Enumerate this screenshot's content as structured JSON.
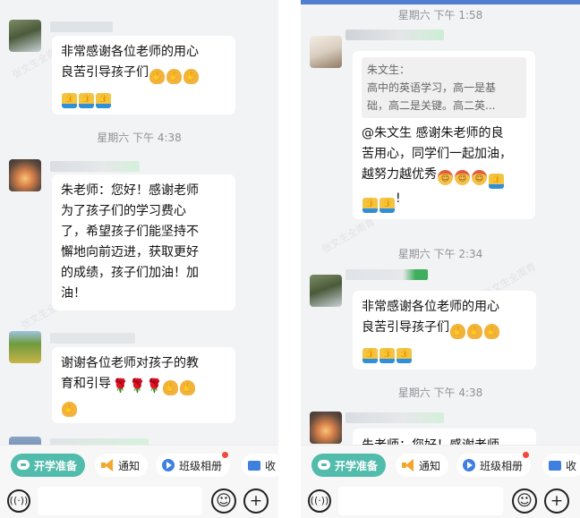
{
  "left": {
    "messages": {
      "m1": {
        "line1": "非常感谢各位老师的用心",
        "line2": "良苦引导孩子们"
      },
      "time1": "星期六  下午 4:38",
      "m2": {
        "lines": [
          "朱老师：您好！感谢老师",
          "为了孩子们的学习费心",
          "了，希望孩子们能坚持不",
          "懈地向前迈进，获取更好",
          "的成绩，孩子们加油！加",
          "油！"
        ]
      },
      "m3": {
        "line1": "谢谢各位老师对孩子的教",
        "line2": "育和引导"
      }
    },
    "toolbar": {
      "start_label": "开学准备",
      "notice_label": "通知",
      "album_label": "班级相册",
      "more_label": "收"
    }
  },
  "right": {
    "messages": {
      "time0": "星期六  下午 1:58",
      "quote": {
        "author": "朱文生：",
        "line1": "高中的英语学习，高一是基",
        "line2": "础，高二是关键。高二英..."
      },
      "reply": {
        "line1": "@朱文生 感谢朱老师的良",
        "line2": "苦用心，同学们一起加油，",
        "line3": "越努力越优秀"
      },
      "time1": "星期六  下午 2:34",
      "m1": {
        "line1": "非常感谢各位老师的用心",
        "line2": "良苦引导孩子们"
      },
      "time2": "星期六  下午 4:38",
      "partial": "朱老师：您好！感谢老师"
    },
    "toolbar": {
      "start_label": "开学准备",
      "notice_label": "通知",
      "album_label": "班级相册",
      "more_label": "收"
    }
  },
  "icons": {
    "pray": "pray-emoji",
    "thumb": "thumbs-up-emoji",
    "rose": "rose-emoji",
    "face": "celebration-face-emoji",
    "voice": "voice-icon",
    "emoji_btn": "smiley-icon",
    "plus_btn": "plus-icon"
  },
  "glyphs": {
    "pray": "✋",
    "thumb": "👍",
    "rose": "🌹",
    "face": "☺",
    "voice": "((·))",
    "smile": "☺",
    "plus": "+"
  },
  "watermark": "张文生全南育",
  "colors": {
    "accent_teal": "#52bcac",
    "top_bar_blue": "#4f7fd1",
    "red_dot": "#f04a3e",
    "chat_bg": "#f2f3f5"
  }
}
